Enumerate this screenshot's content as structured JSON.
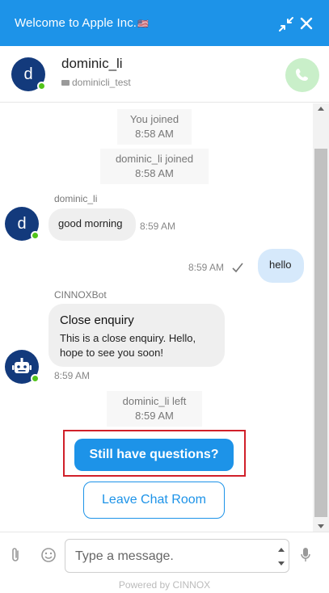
{
  "header": {
    "title": "Welcome to Apple Inc.",
    "title_flag": "🇺🇸",
    "minimize_icon": "minimize-arrows-icon",
    "close_icon": "close-icon"
  },
  "contact": {
    "initial": "d",
    "name": "dominic_li",
    "subname": "dominicli_test",
    "status": "online",
    "call_icon": "phone-icon"
  },
  "messages": {
    "sys1": {
      "text": "You joined",
      "time": "8:58 AM"
    },
    "sys2": {
      "text": "dominic_li joined",
      "time": "8:58 AM"
    },
    "user_msg": {
      "sender": "dominic_li",
      "avatar": "d",
      "text": "good morning",
      "time": "8:59 AM"
    },
    "my_msg": {
      "text": "hello",
      "time": "8:59 AM",
      "status_icon": "checkmark-icon"
    },
    "bot_msg": {
      "sender": "CINNOXBot",
      "title": "Close enquiry",
      "body": "This is a close enquiry. Hello, hope to see you soon!",
      "time": "8:59 AM",
      "avatar_icon": "robot-icon"
    },
    "sys3": {
      "text": "dominic_li left",
      "time": "8:59 AM"
    }
  },
  "actions": {
    "primary": "Still have questions?",
    "secondary": "Leave Chat Room"
  },
  "composer": {
    "placeholder": "Type a message.",
    "attach_icon": "paperclip-icon",
    "emoji_icon": "emoji-icon",
    "mic_icon": "microphone-icon"
  },
  "footer": {
    "powered_by": "Powered by CINNOX"
  },
  "colors": {
    "brand": "#1d93e8",
    "avatar": "#133a7c",
    "online": "#52c41a",
    "highlight": "#d0202a",
    "call_button": "#c9efc9"
  }
}
